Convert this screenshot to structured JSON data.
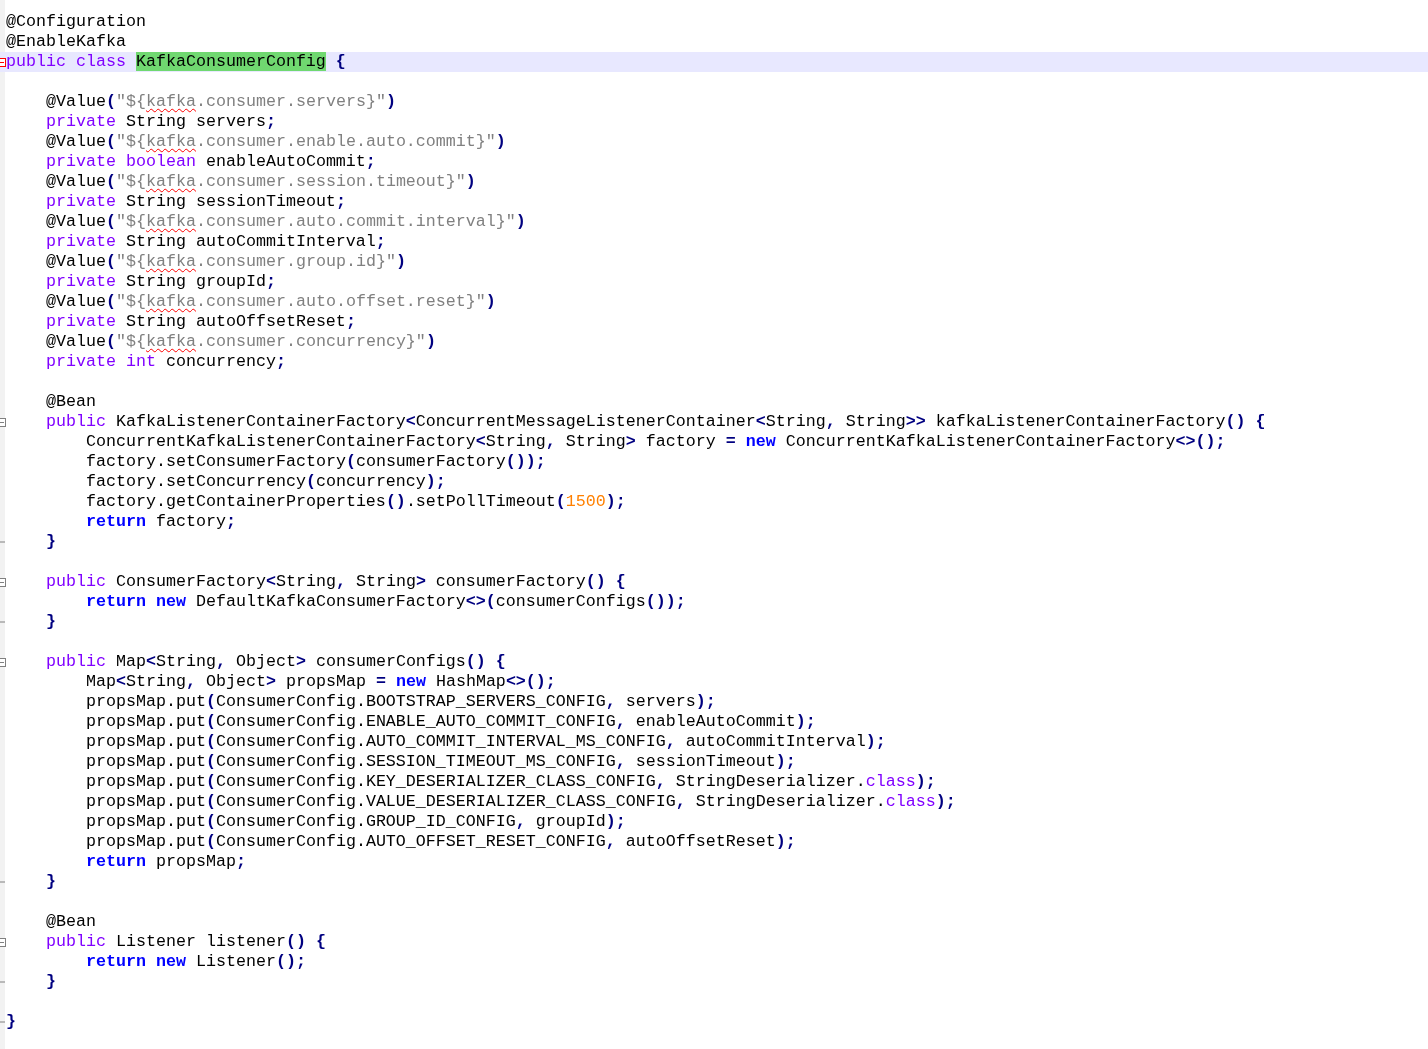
{
  "lines": [
    {
      "kind": "code",
      "tokens": [
        {
          "kind": "plain",
          "text": "@Configuration"
        }
      ]
    },
    {
      "kind": "code",
      "tokens": [
        {
          "kind": "plain",
          "text": "@EnableKafka"
        }
      ]
    },
    {
      "kind": "code",
      "current": true,
      "fold_open": true,
      "tokens": [
        {
          "kind": "keyword",
          "text": "public"
        },
        {
          "kind": "keyword",
          "text": " class "
        },
        {
          "kind": "match",
          "text": "KafkaConsumerConfig"
        },
        {
          "kind": "operator",
          "text": " {"
        }
      ],
      "children": [
        {
          "kind": "blank"
        },
        {
          "kind": "code",
          "tokens": [
            {
              "kind": "plain",
              "text": "@Value"
            },
            {
              "kind": "operator",
              "text": "("
            },
            {
              "kind": "string",
              "text": "\"${"
            },
            {
              "kind": "misspelled",
              "text": "kafka"
            },
            {
              "kind": "string",
              "text": ".consumer.servers}\""
            },
            {
              "kind": "operator",
              "text": ")"
            }
          ]
        },
        {
          "kind": "code",
          "tokens": [
            {
              "kind": "keyword",
              "text": "private"
            },
            {
              "kind": "plain",
              "text": " String servers"
            },
            {
              "kind": "operator",
              "text": ";"
            }
          ]
        },
        {
          "kind": "code",
          "tokens": [
            {
              "kind": "plain",
              "text": "@Value"
            },
            {
              "kind": "operator",
              "text": "("
            },
            {
              "kind": "string",
              "text": "\"${"
            },
            {
              "kind": "misspelled",
              "text": "kafka"
            },
            {
              "kind": "string",
              "text": ".consumer.enable.auto.commit}\""
            },
            {
              "kind": "operator",
              "text": ")"
            }
          ]
        },
        {
          "kind": "code",
          "tokens": [
            {
              "kind": "keyword",
              "text": "private"
            },
            {
              "kind": "keyword",
              "text": " boolean"
            },
            {
              "kind": "plain",
              "text": " enableAutoCommit"
            },
            {
              "kind": "operator",
              "text": ";"
            }
          ]
        },
        {
          "kind": "code",
          "tokens": [
            {
              "kind": "plain",
              "text": "@Value"
            },
            {
              "kind": "operator",
              "text": "("
            },
            {
              "kind": "string",
              "text": "\"${"
            },
            {
              "kind": "misspelled",
              "text": "kafka"
            },
            {
              "kind": "string",
              "text": ".consumer.session.timeout}\""
            },
            {
              "kind": "operator",
              "text": ")"
            }
          ]
        },
        {
          "kind": "code",
          "tokens": [
            {
              "kind": "keyword",
              "text": "private"
            },
            {
              "kind": "plain",
              "text": " String sessionTimeout"
            },
            {
              "kind": "operator",
              "text": ";"
            }
          ]
        },
        {
          "kind": "code",
          "tokens": [
            {
              "kind": "plain",
              "text": "@Value"
            },
            {
              "kind": "operator",
              "text": "("
            },
            {
              "kind": "string",
              "text": "\"${"
            },
            {
              "kind": "misspelled",
              "text": "kafka"
            },
            {
              "kind": "string",
              "text": ".consumer.auto.commit.interval}\""
            },
            {
              "kind": "operator",
              "text": ")"
            }
          ]
        },
        {
          "kind": "code",
          "tokens": [
            {
              "kind": "keyword",
              "text": "private"
            },
            {
              "kind": "plain",
              "text": " String autoCommitInterval"
            },
            {
              "kind": "operator",
              "text": ";"
            }
          ]
        },
        {
          "kind": "code",
          "tokens": [
            {
              "kind": "plain",
              "text": "@Value"
            },
            {
              "kind": "operator",
              "text": "("
            },
            {
              "kind": "string",
              "text": "\"${"
            },
            {
              "kind": "misspelled",
              "text": "kafka"
            },
            {
              "kind": "string",
              "text": ".consumer.group.id}\""
            },
            {
              "kind": "operator",
              "text": ")"
            }
          ]
        },
        {
          "kind": "code",
          "tokens": [
            {
              "kind": "keyword",
              "text": "private"
            },
            {
              "kind": "plain",
              "text": " String groupId"
            },
            {
              "kind": "operator",
              "text": ";"
            }
          ]
        },
        {
          "kind": "code",
          "tokens": [
            {
              "kind": "plain",
              "text": "@Value"
            },
            {
              "kind": "operator",
              "text": "("
            },
            {
              "kind": "string",
              "text": "\"${"
            },
            {
              "kind": "misspelled",
              "text": "kafka"
            },
            {
              "kind": "string",
              "text": ".consumer.auto.offset.reset}\""
            },
            {
              "kind": "operator",
              "text": ")"
            }
          ]
        },
        {
          "kind": "code",
          "tokens": [
            {
              "kind": "keyword",
              "text": "private"
            },
            {
              "kind": "plain",
              "text": " String autoOffsetReset"
            },
            {
              "kind": "operator",
              "text": ";"
            }
          ]
        },
        {
          "kind": "code",
          "tokens": [
            {
              "kind": "plain",
              "text": "@Value"
            },
            {
              "kind": "operator",
              "text": "("
            },
            {
              "kind": "string",
              "text": "\"${"
            },
            {
              "kind": "misspelled",
              "text": "kafka"
            },
            {
              "kind": "string",
              "text": ".consumer.concurrency}\""
            },
            {
              "kind": "operator",
              "text": ")"
            }
          ]
        },
        {
          "kind": "code",
          "tokens": [
            {
              "kind": "keyword",
              "text": "private"
            },
            {
              "kind": "keyword",
              "text": " int"
            },
            {
              "kind": "plain",
              "text": " concurrency"
            },
            {
              "kind": "operator",
              "text": ";"
            }
          ]
        },
        {
          "kind": "blank"
        },
        {
          "kind": "code",
          "tokens": [
            {
              "kind": "plain",
              "text": "@Bean"
            }
          ]
        },
        {
          "kind": "code",
          "fold_open": true,
          "tokens": [
            {
              "kind": "keyword",
              "text": "public"
            },
            {
              "kind": "plain",
              "text": " KafkaListenerContainerFactory"
            },
            {
              "kind": "operator",
              "text": "<"
            },
            {
              "kind": "plain",
              "text": "ConcurrentMessageListenerContainer"
            },
            {
              "kind": "operator",
              "text": "<"
            },
            {
              "kind": "plain",
              "text": "String"
            },
            {
              "kind": "operator",
              "text": ","
            },
            {
              "kind": "plain",
              "text": " String"
            },
            {
              "kind": "operator",
              "text": ">>"
            },
            {
              "kind": "plain",
              "text": " kafkaListenerContainerFactory"
            },
            {
              "kind": "operator",
              "text": "() {"
            }
          ],
          "children": [
            {
              "kind": "code",
              "tokens": [
                {
                  "kind": "plain",
                  "text": "ConcurrentKafkaListenerContainerFactory"
                },
                {
                  "kind": "operator",
                  "text": "<"
                },
                {
                  "kind": "plain",
                  "text": "String"
                },
                {
                  "kind": "operator",
                  "text": ","
                },
                {
                  "kind": "plain",
                  "text": " String"
                },
                {
                  "kind": "operator",
                  "text": ">"
                },
                {
                  "kind": "plain",
                  "text": " factory "
                },
                {
                  "kind": "operator",
                  "text": "="
                },
                {
                  "kind": "flow",
                  "text": " new"
                },
                {
                  "kind": "plain",
                  "text": " ConcurrentKafkaListenerContainerFactory"
                },
                {
                  "kind": "operator",
                  "text": "<>();"
                }
              ]
            },
            {
              "kind": "code",
              "tokens": [
                {
                  "kind": "plain",
                  "text": "factory.setConsumerFactory"
                },
                {
                  "kind": "operator",
                  "text": "("
                },
                {
                  "kind": "plain",
                  "text": "consumerFactory"
                },
                {
                  "kind": "operator",
                  "text": "());"
                }
              ]
            },
            {
              "kind": "code",
              "tokens": [
                {
                  "kind": "plain",
                  "text": "factory.setConcurrency"
                },
                {
                  "kind": "operator",
                  "text": "("
                },
                {
                  "kind": "plain",
                  "text": "concurrency"
                },
                {
                  "kind": "operator",
                  "text": ");"
                }
              ]
            },
            {
              "kind": "code",
              "tokens": [
                {
                  "kind": "plain",
                  "text": "factory.getContainerProperties"
                },
                {
                  "kind": "operator",
                  "text": "()"
                },
                {
                  "kind": "plain",
                  "text": ".setPollTimeout"
                },
                {
                  "kind": "operator",
                  "text": "("
                },
                {
                  "kind": "number",
                  "text": "1500"
                },
                {
                  "kind": "operator",
                  "text": ");"
                }
              ]
            },
            {
              "kind": "code",
              "tokens": [
                {
                  "kind": "flow",
                  "text": "return"
                },
                {
                  "kind": "plain",
                  "text": " factory"
                },
                {
                  "kind": "operator",
                  "text": ";"
                }
              ]
            }
          ]
        },
        {
          "kind": "code",
          "fold_end": true,
          "tokens": [
            {
              "kind": "operator",
              "text": "}"
            }
          ]
        },
        {
          "kind": "blank"
        },
        {
          "kind": "code",
          "fold_open": true,
          "tokens": [
            {
              "kind": "keyword",
              "text": "public"
            },
            {
              "kind": "plain",
              "text": " ConsumerFactory"
            },
            {
              "kind": "operator",
              "text": "<"
            },
            {
              "kind": "plain",
              "text": "String"
            },
            {
              "kind": "operator",
              "text": ","
            },
            {
              "kind": "plain",
              "text": " String"
            },
            {
              "kind": "operator",
              "text": ">"
            },
            {
              "kind": "plain",
              "text": " consumerFactory"
            },
            {
              "kind": "operator",
              "text": "() {"
            }
          ],
          "children": [
            {
              "kind": "code",
              "tokens": [
                {
                  "kind": "flow",
                  "text": "return new"
                },
                {
                  "kind": "plain",
                  "text": " DefaultKafkaConsumerFactory"
                },
                {
                  "kind": "operator",
                  "text": "<>("
                },
                {
                  "kind": "plain",
                  "text": "consumerConfigs"
                },
                {
                  "kind": "operator",
                  "text": "());"
                }
              ]
            }
          ]
        },
        {
          "kind": "code",
          "fold_end": true,
          "tokens": [
            {
              "kind": "operator",
              "text": "}"
            }
          ]
        },
        {
          "kind": "blank"
        },
        {
          "kind": "code",
          "fold_open": true,
          "tokens": [
            {
              "kind": "keyword",
              "text": "public"
            },
            {
              "kind": "plain",
              "text": " Map"
            },
            {
              "kind": "operator",
              "text": "<"
            },
            {
              "kind": "plain",
              "text": "String"
            },
            {
              "kind": "operator",
              "text": ","
            },
            {
              "kind": "plain",
              "text": " Object"
            },
            {
              "kind": "operator",
              "text": ">"
            },
            {
              "kind": "plain",
              "text": " consumerConfigs"
            },
            {
              "kind": "operator",
              "text": "() {"
            }
          ],
          "children": [
            {
              "kind": "code",
              "tokens": [
                {
                  "kind": "plain",
                  "text": "Map"
                },
                {
                  "kind": "operator",
                  "text": "<"
                },
                {
                  "kind": "plain",
                  "text": "String"
                },
                {
                  "kind": "operator",
                  "text": ","
                },
                {
                  "kind": "plain",
                  "text": " Object"
                },
                {
                  "kind": "operator",
                  "text": ">"
                },
                {
                  "kind": "plain",
                  "text": " propsMap "
                },
                {
                  "kind": "operator",
                  "text": "="
                },
                {
                  "kind": "flow",
                  "text": " new"
                },
                {
                  "kind": "plain",
                  "text": " HashMap"
                },
                {
                  "kind": "operator",
                  "text": "<>();"
                }
              ]
            },
            {
              "kind": "code",
              "tokens": [
                {
                  "kind": "plain",
                  "text": "propsMap.put"
                },
                {
                  "kind": "operator",
                  "text": "("
                },
                {
                  "kind": "plain",
                  "text": "ConsumerConfig.BOOTSTRAP_SERVERS_CONFIG"
                },
                {
                  "kind": "operator",
                  "text": ","
                },
                {
                  "kind": "plain",
                  "text": " servers"
                },
                {
                  "kind": "operator",
                  "text": ");"
                }
              ]
            },
            {
              "kind": "code",
              "tokens": [
                {
                  "kind": "plain",
                  "text": "propsMap.put"
                },
                {
                  "kind": "operator",
                  "text": "("
                },
                {
                  "kind": "plain",
                  "text": "ConsumerConfig.ENABLE_AUTO_COMMIT_CONFIG"
                },
                {
                  "kind": "operator",
                  "text": ","
                },
                {
                  "kind": "plain",
                  "text": " enableAutoCommit"
                },
                {
                  "kind": "operator",
                  "text": ");"
                }
              ]
            },
            {
              "kind": "code",
              "tokens": [
                {
                  "kind": "plain",
                  "text": "propsMap.put"
                },
                {
                  "kind": "operator",
                  "text": "("
                },
                {
                  "kind": "plain",
                  "text": "ConsumerConfig.AUTO_COMMIT_INTERVAL_MS_CONFIG"
                },
                {
                  "kind": "operator",
                  "text": ","
                },
                {
                  "kind": "plain",
                  "text": " autoCommitInterval"
                },
                {
                  "kind": "operator",
                  "text": ");"
                }
              ]
            },
            {
              "kind": "code",
              "tokens": [
                {
                  "kind": "plain",
                  "text": "propsMap.put"
                },
                {
                  "kind": "operator",
                  "text": "("
                },
                {
                  "kind": "plain",
                  "text": "ConsumerConfig.SESSION_TIMEOUT_MS_CONFIG"
                },
                {
                  "kind": "operator",
                  "text": ","
                },
                {
                  "kind": "plain",
                  "text": " sessionTimeout"
                },
                {
                  "kind": "operator",
                  "text": ");"
                }
              ]
            },
            {
              "kind": "code",
              "tokens": [
                {
                  "kind": "plain",
                  "text": "propsMap.put"
                },
                {
                  "kind": "operator",
                  "text": "("
                },
                {
                  "kind": "plain",
                  "text": "ConsumerConfig.KEY_DESERIALIZER_CLASS_CONFIG"
                },
                {
                  "kind": "operator",
                  "text": ","
                },
                {
                  "kind": "plain",
                  "text": " StringDeserializer."
                },
                {
                  "kind": "keyword",
                  "text": "class"
                },
                {
                  "kind": "operator",
                  "text": ");"
                }
              ]
            },
            {
              "kind": "code",
              "tokens": [
                {
                  "kind": "plain",
                  "text": "propsMap.put"
                },
                {
                  "kind": "operator",
                  "text": "("
                },
                {
                  "kind": "plain",
                  "text": "ConsumerConfig.VALUE_DESERIALIZER_CLASS_CONFIG"
                },
                {
                  "kind": "operator",
                  "text": ","
                },
                {
                  "kind": "plain",
                  "text": " StringDeserializer."
                },
                {
                  "kind": "keyword",
                  "text": "class"
                },
                {
                  "kind": "operator",
                  "text": ");"
                }
              ]
            },
            {
              "kind": "code",
              "tokens": [
                {
                  "kind": "plain",
                  "text": "propsMap.put"
                },
                {
                  "kind": "operator",
                  "text": "("
                },
                {
                  "kind": "plain",
                  "text": "ConsumerConfig.GROUP_ID_CONFIG"
                },
                {
                  "kind": "operator",
                  "text": ","
                },
                {
                  "kind": "plain",
                  "text": " groupId"
                },
                {
                  "kind": "operator",
                  "text": ");"
                }
              ]
            },
            {
              "kind": "code",
              "tokens": [
                {
                  "kind": "plain",
                  "text": "propsMap.put"
                },
                {
                  "kind": "operator",
                  "text": "("
                },
                {
                  "kind": "plain",
                  "text": "ConsumerConfig.AUTO_OFFSET_RESET_CONFIG"
                },
                {
                  "kind": "operator",
                  "text": ","
                },
                {
                  "kind": "plain",
                  "text": " autoOffsetReset"
                },
                {
                  "kind": "operator",
                  "text": ");"
                }
              ]
            },
            {
              "kind": "code",
              "tokens": [
                {
                  "kind": "flow",
                  "text": "return"
                },
                {
                  "kind": "plain",
                  "text": " propsMap"
                },
                {
                  "kind": "operator",
                  "text": ";"
                }
              ]
            }
          ]
        },
        {
          "kind": "code",
          "fold_end": true,
          "tokens": [
            {
              "kind": "operator",
              "text": "}"
            }
          ]
        },
        {
          "kind": "blank"
        },
        {
          "kind": "code",
          "tokens": [
            {
              "kind": "plain",
              "text": "@Bean"
            }
          ]
        },
        {
          "kind": "code",
          "fold_open": true,
          "tokens": [
            {
              "kind": "keyword",
              "text": "public"
            },
            {
              "kind": "plain",
              "text": " Listener listener"
            },
            {
              "kind": "operator",
              "text": "() {"
            }
          ],
          "children": [
            {
              "kind": "code",
              "tokens": [
                {
                  "kind": "flow",
                  "text": "return new"
                },
                {
                  "kind": "plain",
                  "text": " Listener"
                },
                {
                  "kind": "operator",
                  "text": "();"
                }
              ]
            }
          ]
        },
        {
          "kind": "code",
          "fold_end": true,
          "tokens": [
            {
              "kind": "operator",
              "text": "}"
            }
          ]
        },
        {
          "kind": "blank"
        }
      ]
    },
    {
      "kind": "code",
      "fold_end": true,
      "tokens": [
        {
          "kind": "operator",
          "text": "}"
        }
      ]
    }
  ]
}
